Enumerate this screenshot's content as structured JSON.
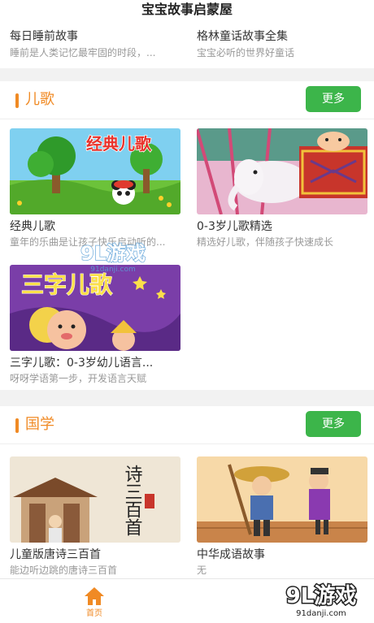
{
  "app": {
    "title": "宝宝故事启蒙屋"
  },
  "top_stories": [
    {
      "title": "每日睡前故事",
      "subtitle": "睡前是人类记忆最牢固的时段，..."
    },
    {
      "title": "格林童话故事全集",
      "subtitle": "宝宝必听的世界好童话"
    }
  ],
  "sections": [
    {
      "title": "儿歌",
      "more_label": "更多",
      "items": [
        {
          "title": "经典儿歌",
          "subtitle": "童年的乐曲是让孩子快乐启动听的...",
          "thumb_text": "经典儿歌"
        },
        {
          "title": "0-3岁儿歌精选",
          "subtitle": "精选好儿歌，伴随孩子快速成长"
        },
        {
          "title": "三字儿歌：0-3岁幼儿语言...",
          "subtitle": "呀呀学语第一步，开发语言天赋",
          "thumb_text": "三字儿歌"
        }
      ]
    },
    {
      "title": "国学",
      "more_label": "更多",
      "items": [
        {
          "title": "儿童版唐诗三百首",
          "subtitle": "能边听边跳的唐诗三百首",
          "thumb_text": "诗三百首"
        },
        {
          "title": "中华成语故事",
          "subtitle": "无"
        }
      ]
    }
  ],
  "tabbar": {
    "home_label": "首页"
  },
  "watermark": {
    "logo_text": "9L游戏",
    "site": "91danji.com"
  },
  "colors": {
    "accent": "#f08a24",
    "button": "#3cb54a",
    "subtitle": "#999999"
  },
  "icons": {
    "home": "home-icon"
  }
}
